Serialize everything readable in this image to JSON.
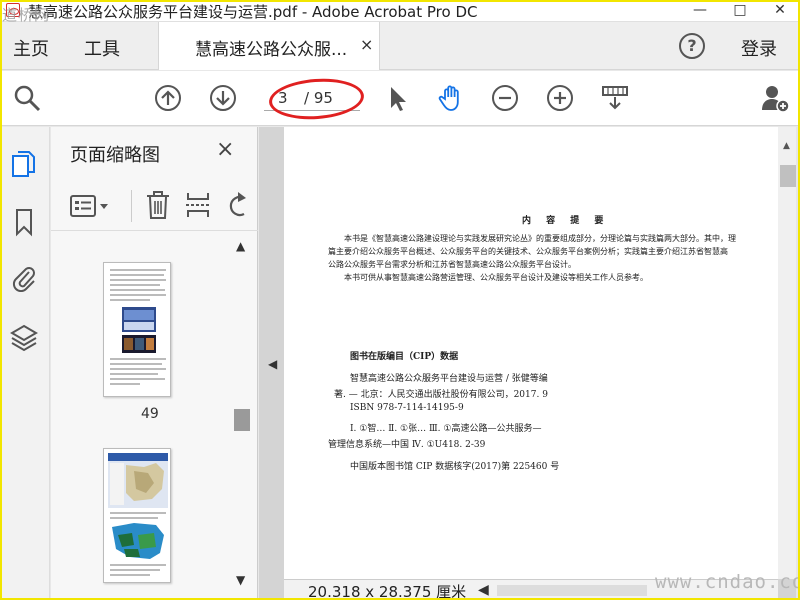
{
  "window": {
    "title": "慧高速公路公众服务平台建设与运营.pdf - Adobe Acrobat Pro DC",
    "watermark_top": "道桥网",
    "minimize": "—",
    "maximize": "□",
    "close": "✕"
  },
  "tabbar": {
    "home": "主页",
    "tools": "工具",
    "doc_tab": "慧高速公路公众服...",
    "doc_tab_close": "×",
    "help": "?",
    "login": "登录"
  },
  "toolbar": {
    "current_page": "3",
    "page_total": "/ 95",
    "icons": [
      "search-zoom-icon",
      "page-up-icon",
      "page-down-icon",
      "select-pointer-icon",
      "hand-icon",
      "zoom-out-icon",
      "zoom-in-icon",
      "scroll-mode-icon",
      "share-user-icon"
    ]
  },
  "left_rail": {
    "icons": [
      "page-thumbnails-icon",
      "bookmarks-icon",
      "attachments-icon",
      "layers-icon"
    ]
  },
  "thumbnail_panel": {
    "title": "页面缩略图",
    "close": "×",
    "thumb_page_label": "49",
    "tool_icons": [
      "thumbnail-options-icon",
      "delete-icon",
      "extract-icon",
      "rotate-icon"
    ]
  },
  "document": {
    "summary_title": "内 容 提 要",
    "summary_lines": [
      "本书是《智慧高速公路建设理论与实践发展研究论丛》的重要组成部分，分理论篇与实践篇两大部分。其中，理",
      "篇主要介绍公众服务平台概述、公众服务平台的关键技术、公众服务平台案例分析；实践篇主要介绍江苏省智慧高",
      "公路公众服务平台需求分析和江苏省智慧高速公路公众服务平台设计。",
      "本书可供从事智慧高速公路营运管理、公众服务平台设计及建设等相关工作人员参考。"
    ],
    "cip_heading": "图书在版编目（CIP）数据",
    "cip_lines": [
      "智慧高速公路公众服务平台建设与运营 / 张健等编",
      "著. — 北京：人民交通出版社股份有限公司，2017. 9",
      "ISBN 978-7-114-14195-9",
      "Ⅰ. ①智…  Ⅱ. ①张…  Ⅲ. ①高速公路—公共服务—",
      "管理信息系统—中国  Ⅳ. ①U418. 2-39",
      "中国版本图书馆 CIP 数据核字(2017)第 225460 号"
    ]
  },
  "status": {
    "dimensions": "20.318 x 28.375 厘米",
    "watermark_bottom": "www.cndao.com"
  },
  "colors": {
    "accent_blue": "#1473e6",
    "annotation_red": "#e02020",
    "frame_yellow": "#f2e600"
  }
}
